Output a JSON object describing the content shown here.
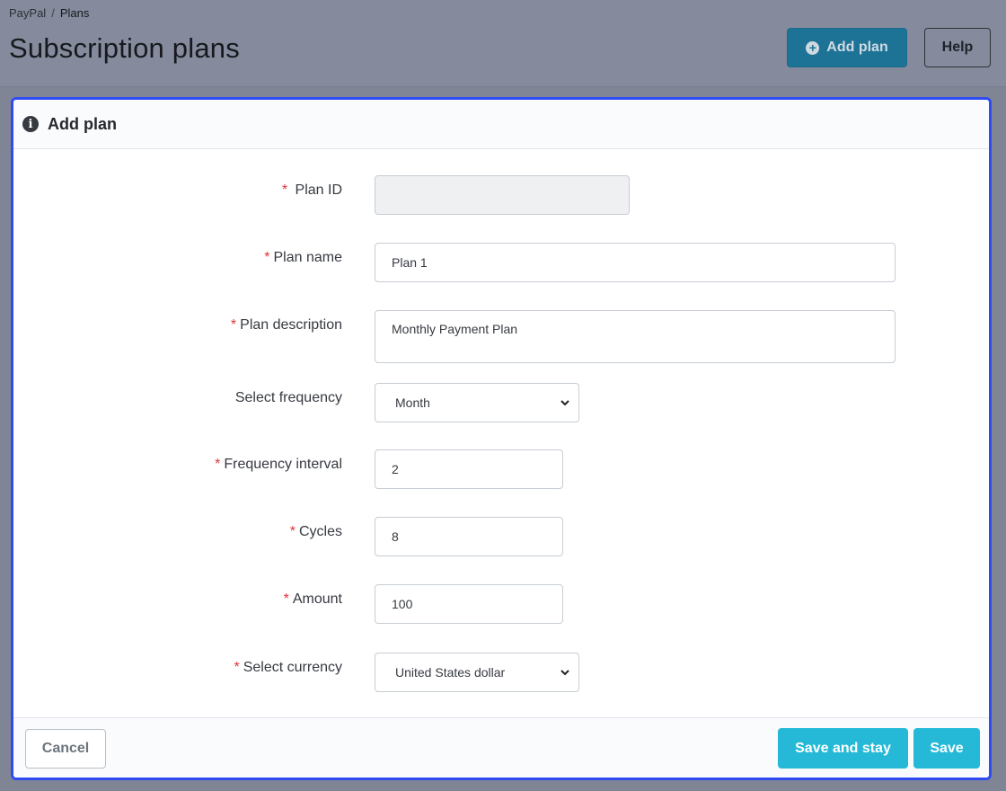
{
  "breadcrumb": {
    "parent": "PayPal",
    "separator": "/",
    "current": "Plans"
  },
  "header": {
    "title": "Subscription plans",
    "add_plan_label": "Add plan",
    "help_label": "Help"
  },
  "card": {
    "title": "Add plan",
    "fields": {
      "plan_id": {
        "label": "Plan ID",
        "required": "*",
        "value": ""
      },
      "plan_name": {
        "label": "Plan name",
        "required": "*",
        "value": "Plan 1"
      },
      "plan_description": {
        "label": "Plan description",
        "required": "*",
        "value": "Monthly Payment Plan"
      },
      "frequency": {
        "label": "Select frequency",
        "value": "Month"
      },
      "frequency_interval": {
        "label": "Frequency interval",
        "required": "*",
        "value": "2"
      },
      "cycles": {
        "label": "Cycles",
        "required": "*",
        "value": "8"
      },
      "amount": {
        "label": "Amount",
        "required": "*",
        "value": "100"
      },
      "currency": {
        "label": "Select currency",
        "required": "*",
        "value": "United States dollar"
      }
    }
  },
  "footer": {
    "cancel_label": "Cancel",
    "save_stay_label": "Save and stay",
    "save_label": "Save"
  },
  "colors": {
    "accent": "#25b9d7",
    "add_plan_button": "#1d7396",
    "focus_border": "#2f4bf0",
    "required": "#e0343a"
  },
  "icons": {
    "add_plan": "plus-circle-icon",
    "card_header": "info-icon",
    "select": "chevron-down-icon"
  }
}
